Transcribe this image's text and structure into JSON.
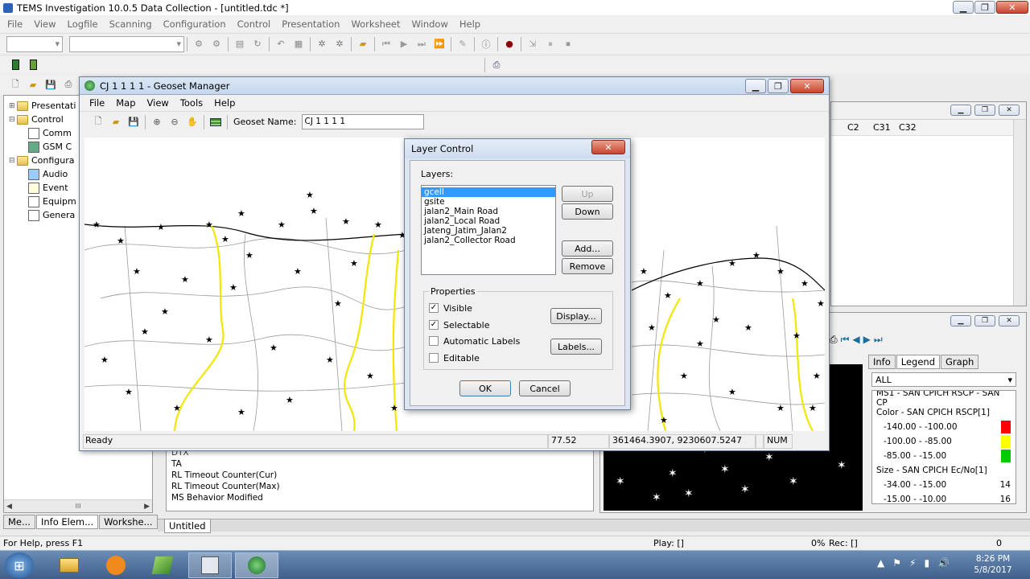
{
  "app": {
    "title": "TEMS Investigation 10.0.5 Data Collection - [untitled.tdc *]",
    "menu": [
      "File",
      "View",
      "Logfile",
      "Scanning",
      "Configuration",
      "Control",
      "Presentation",
      "Worksheet",
      "Window",
      "Help"
    ],
    "status_left": "For Help, press F1",
    "status_play": "Play: []",
    "status_pct": "0%",
    "status_rec": "Rec: []",
    "status_right": "0"
  },
  "navigator": {
    "items": [
      {
        "label": "Presentati",
        "level": 0,
        "expander": "+"
      },
      {
        "label": "Control",
        "level": 0,
        "expander": "−"
      },
      {
        "label": "Comm",
        "level": 1
      },
      {
        "label": "GSM C",
        "level": 1
      },
      {
        "label": "Configura",
        "level": 0,
        "expander": "−"
      },
      {
        "label": "Audio",
        "level": 1
      },
      {
        "label": "Event",
        "level": 1
      },
      {
        "label": "Equipm",
        "level": 1
      },
      {
        "label": "Genera",
        "level": 1
      }
    ],
    "tabs": [
      "Me...",
      "Info Elem...",
      "Workshe..."
    ],
    "scroll_glyph": "III"
  },
  "worksheet_tab": "Untitled",
  "ie_list": [
    "DTX",
    "TA",
    "RL Timeout Counter(Cur)",
    "RL Timeout Counter(Max)",
    "MS Behavior Modified"
  ],
  "right_table": {
    "headers": [
      "C2",
      "C31",
      "C32"
    ]
  },
  "legend_panel": {
    "tabs": [
      "Info",
      "Legend",
      "Graph"
    ],
    "active_tab": "Legend",
    "dropdown": "ALL",
    "title": "MS1 - SAN CPICH RSCP - SAN CP",
    "color_header": "Color - SAN CPICH RSCP[1]",
    "color_rows": [
      {
        "range": "-140.00 - -100.00",
        "color": "#ff0000"
      },
      {
        "range": "-100.00 - -85.00",
        "color": "#ffff00"
      },
      {
        "range": "-85.00 - -15.00",
        "color": "#00cc00"
      }
    ],
    "size_header": "Size - SAN CPICH Ec/No[1]",
    "size_rows": [
      {
        "range": "-34.00 - -15.00",
        "value": "14"
      },
      {
        "range": "-15.00 - -10.00",
        "value": "16"
      }
    ]
  },
  "geoset": {
    "title": "CJ 1 1 1 1 - Geoset Manager",
    "menu": [
      "File",
      "Map",
      "View",
      "Tools",
      "Help"
    ],
    "geoset_name_label": "Geoset Name:",
    "geoset_name_value": "CJ 1 1 1 1",
    "status": [
      "Ready",
      "77.52",
      "361464.3907, 9230607.5247",
      "",
      "NUM"
    ]
  },
  "layer_control": {
    "title": "Layer Control",
    "layers_label": "Layers:",
    "layers": [
      "gcell",
      "gsite",
      "jalan2_Main Road",
      "jalan2_Local Road",
      "Jateng_Jatim_Jalan2",
      "jalan2_Collector Road"
    ],
    "selected_index": 0,
    "buttons": {
      "up": "Up",
      "down": "Down",
      "add": "Add...",
      "remove": "Remove",
      "display": "Display...",
      "labels": "Labels...",
      "ok": "OK",
      "cancel": "Cancel"
    },
    "properties_label": "Properties",
    "checks": [
      {
        "label": "Visible",
        "checked": true
      },
      {
        "label": "Selectable",
        "checked": true
      },
      {
        "label": "Automatic Labels",
        "checked": false
      },
      {
        "label": "Editable",
        "checked": false
      }
    ]
  },
  "taskbar": {
    "time": "8:26 PM",
    "date": "5/8/2017"
  }
}
